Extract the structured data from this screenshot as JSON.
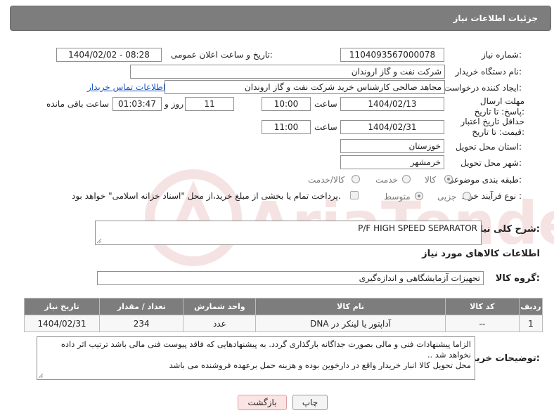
{
  "header": {
    "title": "جزئیات اطلاعات نیاز"
  },
  "fields": {
    "need_number_label": "شماره نیاز:",
    "need_number": "1104093567000078",
    "announce_label": "تاریخ و ساعت اعلان عمومی:",
    "announce_value": "1404/02/02 - 08:28",
    "buyer_org_label": "نام دستگاه خریدار:",
    "buyer_org": "شرکت نفت و گاز اروندان",
    "creator_label": "ایجاد کننده درخواست:",
    "creator": "مجاهد صالحی کارشناس خرید شرکت نفت و گاز اروندان",
    "contact_link": "اطلاعات تماس خریدار",
    "reply_deadline_label": "مهلت ارسال پاسخ: تا تاریخ:",
    "reply_date": "1404/02/13",
    "time_label": "ساعت",
    "reply_time": "10:00",
    "days_value": "11",
    "days_label": "روز و",
    "remaining_value": "01:03:47",
    "remaining_label": "ساعت باقی مانده",
    "price_deadline_label": "حداقل تاریخ اعتبار قیمت: تا تاریخ:",
    "price_date": "1404/02/31",
    "price_time": "11:00",
    "province_label": "استان محل تحویل:",
    "province": "خوزستان",
    "city_label": "شهر محل تحویل:",
    "city": "خرمشهر",
    "category_label": "طبقه بندی موضوعی:",
    "category_options": [
      "کالا",
      "خدمت",
      "کالا/خدمت"
    ],
    "process_label": "نوع فرآیند خرید :",
    "process_options": [
      "جزیی",
      "متوسط"
    ],
    "payment_note": "پرداخت تمام یا بخشی از مبلغ خرید،از محل \"اسناد خزانه اسلامی\" خواهد بود.",
    "description_label": "شرح کلی نیاز:",
    "description": "P/F HIGH SPEED SEPARATOR",
    "goods_info_title": "اطلاعات کالاهای مورد نیاز",
    "goods_group_label": "گروه کالا:",
    "goods_group": "تجهیزات آزمایشگاهی و اندازه‌گیری"
  },
  "table": {
    "headers": [
      "ردیف",
      "کد کالا",
      "نام کالا",
      "واحد شمارش",
      "تعداد / مقدار",
      "تاریخ نیاز"
    ],
    "rows": [
      [
        "1",
        "--",
        "آداپتور یا لینکر در DNA",
        "عدد",
        "234",
        "1404/02/31"
      ]
    ]
  },
  "buyer_notes": {
    "label": "توضیحات خریدار:",
    "text": "الزاما  پیشنهادات فنی و مالی بصورت جداگانه بارگذاری گردد. به پیشنهادهایی که فاقد پیوست فنی مالی باشد ترتیب اثر داده نخواهد شد ..\nمحل تحویل کالا انبار خریدار واقع در  دارخوین بوده و هزینه حمل برعهده فروشنده می باشد"
  },
  "buttons": {
    "print": "چاپ",
    "back": "بازگشت"
  },
  "watermark": {
    "text": "AriaTender.neT"
  }
}
